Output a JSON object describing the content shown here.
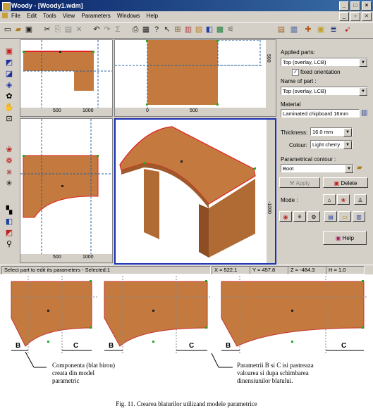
{
  "window": {
    "title": "Woody - [Woody1.wdm]"
  },
  "menu": [
    "File",
    "Edit",
    "Tools",
    "View",
    "Parameters",
    "Windows",
    "Help"
  ],
  "views": {
    "top_left_ruler": [
      "500",
      "1000"
    ],
    "top_right_ruler_x": [
      "0",
      "500"
    ],
    "top_right_ruler_y": "500",
    "bottom_left_ruler": [
      "500",
      "1000"
    ],
    "persp_ruler_y": "-1000"
  },
  "panel": {
    "applied_parts_label": "Applied parts:",
    "applied_parts_value": "Top (overlay, LCB)",
    "fixed_orientation": "fixed orientation",
    "name_of_part_label": "Name of part :",
    "name_of_part_value": "Top (overlay, LCB)",
    "material_label": "Material",
    "material_value": "Laminated chipboard 16mm",
    "thickness_label": "Thickness:",
    "thickness_value": "16.0 mm",
    "colour_label": "Colour:",
    "colour_value": "Light cherry",
    "contour_label": "Parametrical contour :",
    "contour_value": "Boot",
    "apply_label": "Apply",
    "delete_label": "Delete",
    "mode_label": "Mode :",
    "help_label": "Help"
  },
  "status": {
    "message": "Select part to edit its parameters - Selected:1",
    "x": "X = 522.1",
    "y": "Y = 457.8",
    "z": "Z = -484.3",
    "h": "H = 1.0"
  },
  "figure": {
    "label_b": "B",
    "label_c": "C",
    "callout_left": [
      "Componenta (blat birou)",
      "creata din model",
      "parametric"
    ],
    "callout_right": [
      "Parametrii B si C isi pastreaza",
      "valoarea si dupa schimbarea",
      "dinensiunilor blatului."
    ],
    "caption": "Fig. 11. Crearea blaturilor utilizand modele parametrice"
  },
  "colors": {
    "wood": "#c47a3e",
    "wood_dark": "#9e5a2a",
    "outline": "#e02020",
    "node": "#22aa22",
    "active_view": "#1a2fb0"
  }
}
